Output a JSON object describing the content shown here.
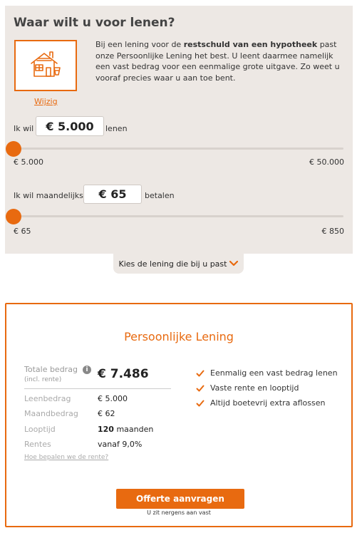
{
  "calculator": {
    "title": "Waar wilt u voor lenen?",
    "purpose": {
      "icon": "house-icon",
      "change_link": "Wijzig",
      "text_before": "Bij een lening voor de ",
      "text_bold": "restschuld van een hypotheek",
      "text_after": " past onze Persoonlijke Lening het best. U leent daarmee namelijk een vast bedrag voor een eenmalige grote uitgave. Zo weet u vooraf precies waar u aan toe bent."
    },
    "loan_amount": {
      "prefix": "Ik wil",
      "value": "€ 5.000",
      "suffix": "lenen",
      "min_label": "€ 5.000",
      "max_label": "€ 50.000",
      "slider_fraction": 0
    },
    "monthly_amount": {
      "prefix": "Ik wil maandelijks",
      "value": "€ 65",
      "suffix": "betalen",
      "min_label": "€ 65",
      "max_label": "€ 850",
      "slider_fraction": 0
    },
    "choose_tab_label": "Kies de lening die bij u past"
  },
  "product": {
    "title": "Persoonlijke Lening",
    "total_label": "Totale bedrag",
    "total_sublabel": "(incl. rente)",
    "total_value": "€ 7.486",
    "details": [
      {
        "label": "Leenbedrag",
        "value": "€ 5.000",
        "unit": ""
      },
      {
        "label": "Maandbedrag",
        "value": "€ 62",
        "unit": ""
      },
      {
        "label": "Looptijd",
        "value": "120",
        "unit": " maanden"
      },
      {
        "label": "Rentes",
        "value": "vanaf 9,0%",
        "unit": ""
      }
    ],
    "explain_link": "Hoe bepalen we de rente?",
    "features": [
      "Eenmalig een vast bedrag lenen",
      "Vaste rente en looptijd",
      "Altijd boetevrij extra aflossen"
    ],
    "cta_label": "Offerte aanvragen",
    "cta_note": "U zit nergens aan vast"
  },
  "colors": {
    "accent": "#e86a10",
    "panel_bg": "#ede8e4"
  }
}
